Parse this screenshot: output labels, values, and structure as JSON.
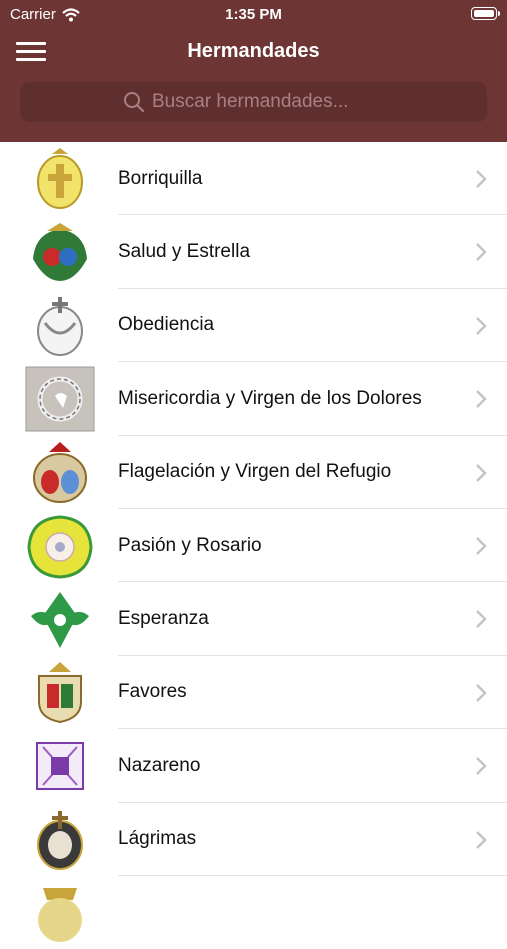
{
  "status": {
    "carrier": "Carrier",
    "time": "1:35 PM"
  },
  "nav": {
    "title": "Hermandades"
  },
  "search": {
    "placeholder": "Buscar hermandades..."
  },
  "colors": {
    "brand": "#6e3535",
    "search_bg": "#5f2e2e"
  },
  "items": [
    {
      "label": "Borriquilla",
      "icon": "crest-icon"
    },
    {
      "label": "Salud y Estrella",
      "icon": "crest-icon"
    },
    {
      "label": "Obediencia",
      "icon": "crest-icon"
    },
    {
      "label": "Misericordia y Virgen de los Dolores",
      "icon": "crest-icon"
    },
    {
      "label": "Flagelación y Virgen del Refugio",
      "icon": "crest-icon"
    },
    {
      "label": "Pasión y Rosario",
      "icon": "crest-icon"
    },
    {
      "label": "Esperanza",
      "icon": "crest-icon"
    },
    {
      "label": "Favores",
      "icon": "crest-icon"
    },
    {
      "label": "Nazareno",
      "icon": "crest-icon"
    },
    {
      "label": "Lágrimas",
      "icon": "crest-icon"
    }
  ]
}
